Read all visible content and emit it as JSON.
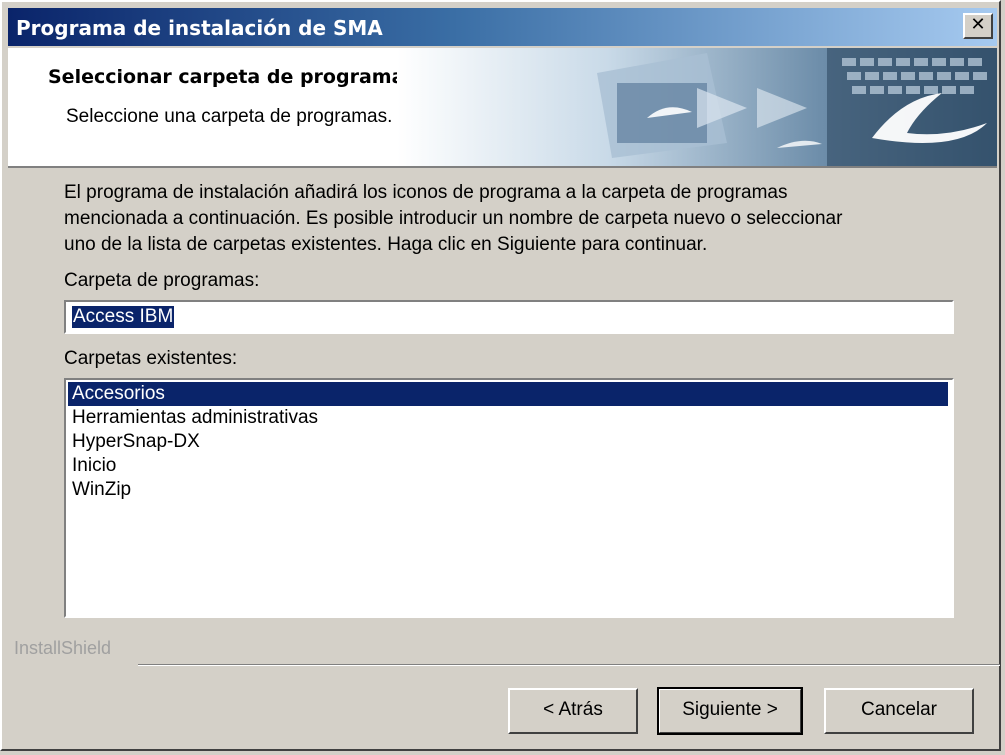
{
  "window": {
    "title": "Programa de instalación de SMA",
    "close_glyph": "✕"
  },
  "header": {
    "title": "Seleccionar carpeta de programas",
    "subtitle": "Seleccione una carpeta de programas."
  },
  "body": {
    "description_lines": [
      "El programa de instalación añadirá los iconos de programa a la carpeta de programas",
      "mencionada a continuación.  Es posible introducir un nombre de carpeta nuevo o seleccionar",
      "uno de la lista de carpetas existentes.  Haga clic en Siguiente para continuar."
    ],
    "folder_label": "Carpeta de programas:",
    "folder_value": "Access IBM",
    "existing_label": "Carpetas existentes:",
    "existing_folders": [
      "Accesorios",
      "Herramientas administrativas",
      "HyperSnap-DX",
      "Inicio",
      "WinZip"
    ],
    "selected_folder": "Accesorios"
  },
  "footer": {
    "brand": "InstallShield",
    "buttons": {
      "back": "< Atrás",
      "next": "Siguiente >",
      "cancel": "Cancelar"
    }
  },
  "colors": {
    "title_bar": "#0a246a",
    "selection": "#0a246a",
    "face": "#d4d0c8"
  }
}
